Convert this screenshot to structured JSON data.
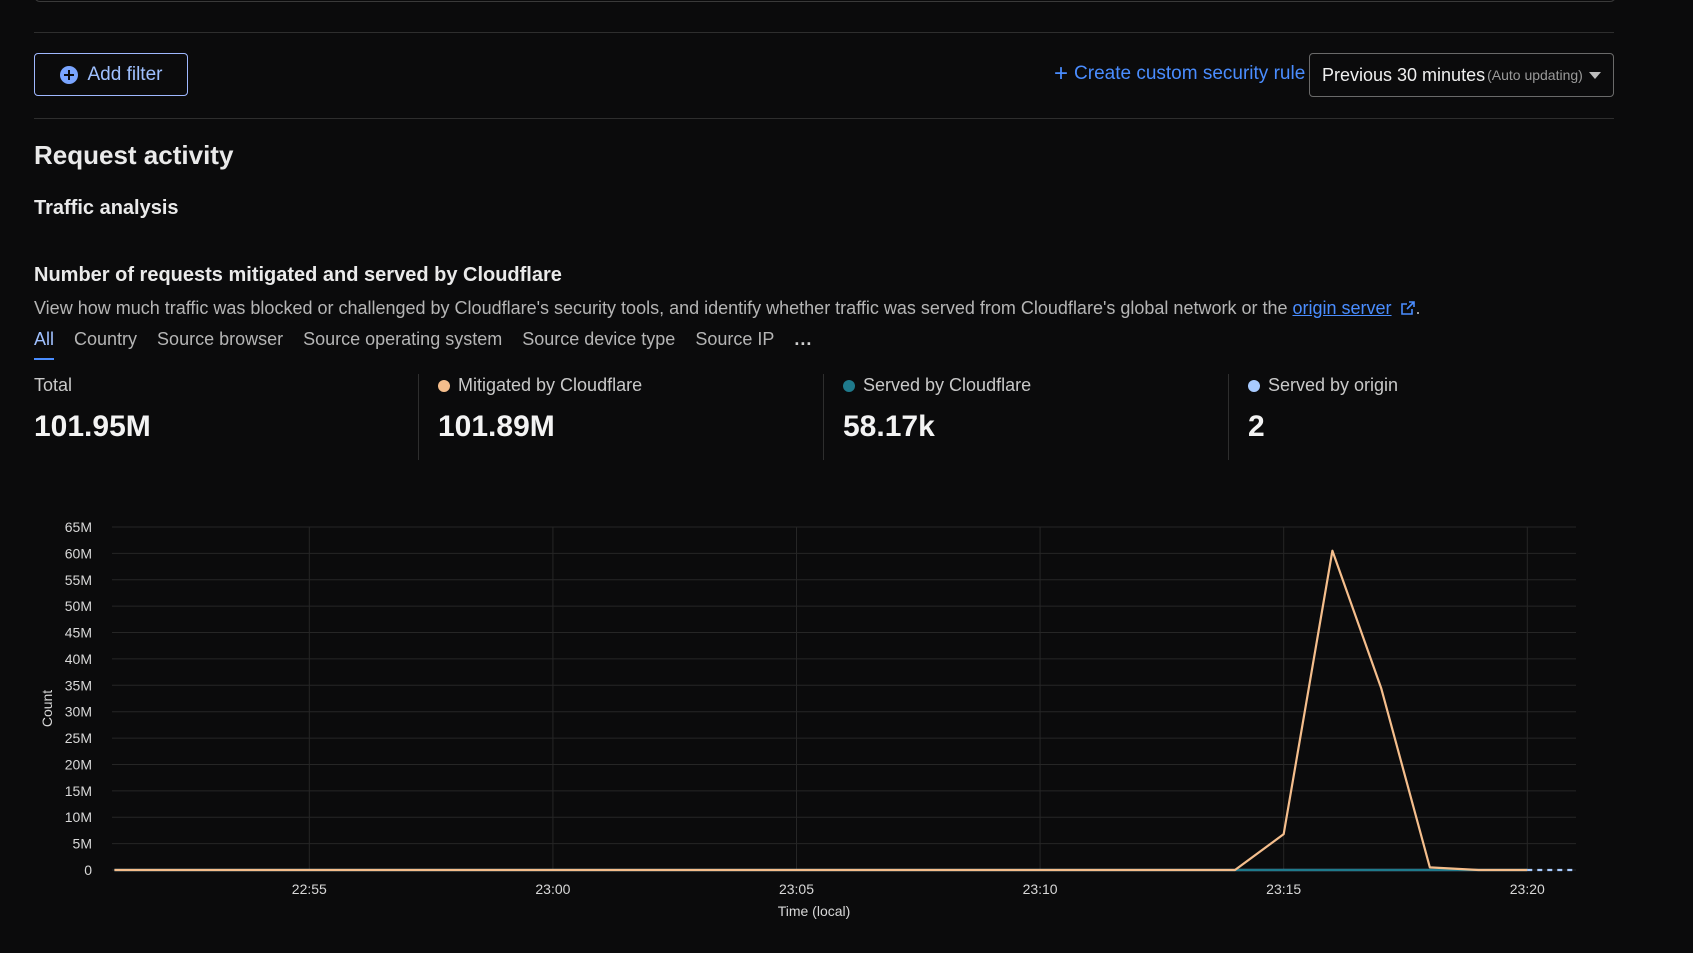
{
  "toolbar": {
    "add_filter_label": "Add filter",
    "create_rule_label": "Create custom security rule",
    "range_label": "Previous 30 minutes",
    "range_sub": "(Auto updating)"
  },
  "section": {
    "title": "Request activity",
    "subtitle": "Traffic analysis"
  },
  "panel": {
    "title": "Number of requests mitigated and served by Cloudflare",
    "description_prefix": "View how much traffic was blocked or challenged by Cloudflare's security tools, and identify whether traffic was served from Cloudflare's global network or the ",
    "description_link": "origin server",
    "description_suffix": "."
  },
  "tabs": [
    "All",
    "Country",
    "Source browser",
    "Source operating system",
    "Source device type",
    "Source IP"
  ],
  "tabs_more": "...",
  "stats": {
    "total": {
      "label": "Total",
      "value": "101.95M"
    },
    "mitigated": {
      "label": "Mitigated by Cloudflare",
      "value": "101.89M",
      "color": "#f5be8c"
    },
    "served_cf": {
      "label": "Served by Cloudflare",
      "value": "58.17k",
      "color": "#1f7a8c"
    },
    "served_origin": {
      "label": "Served by origin",
      "value": "2",
      "color": "#a8cbff"
    }
  },
  "colors": {
    "accent": "#4a8dff",
    "mitigated": "#f5be8c",
    "served_cf": "#1f7a8c",
    "served_origin": "#a8cbff"
  },
  "chart_data": {
    "type": "line",
    "xlabel": "Time (local)",
    "ylabel": "Count",
    "ylim": [
      0,
      65000000
    ],
    "y_ticks": [
      "0",
      "5M",
      "10M",
      "15M",
      "20M",
      "25M",
      "30M",
      "35M",
      "40M",
      "45M",
      "50M",
      "55M",
      "60M",
      "65M"
    ],
    "x_ticks": [
      "22:55",
      "23:00",
      "23:05",
      "23:10",
      "23:15",
      "23:20"
    ],
    "grid": true,
    "series": [
      {
        "name": "Mitigated by Cloudflare",
        "color": "#f5be8c",
        "points": [
          {
            "x": "22:51",
            "y": 0
          },
          {
            "x": "23:14",
            "y": 0
          },
          {
            "x": "23:15",
            "y": 6800000
          },
          {
            "x": "23:16",
            "y": 60500000
          },
          {
            "x": "23:17",
            "y": 34500000
          },
          {
            "x": "23:18",
            "y": 500000
          },
          {
            "x": "23:19",
            "y": 0
          },
          {
            "x": "23:20",
            "y": 0
          }
        ]
      },
      {
        "name": "Served by Cloudflare",
        "color": "#1f7a8c",
        "points": [
          {
            "x": "22:51",
            "y": 0
          },
          {
            "x": "23:20",
            "y": 0
          }
        ]
      },
      {
        "name": "Served by origin",
        "color": "#a8cbff",
        "points": [
          {
            "x": "22:51",
            "y": 0
          },
          {
            "x": "23:20",
            "y": 0
          }
        ]
      }
    ]
  }
}
